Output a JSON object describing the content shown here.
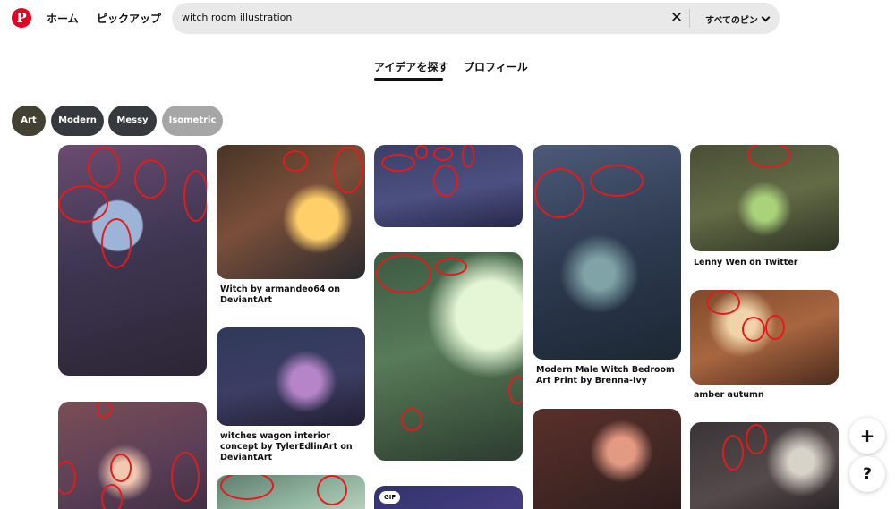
{
  "header": {
    "logo": "P",
    "nav": {
      "home": "ホーム",
      "pickup": "ピックアップ"
    },
    "search": {
      "value": "witch room illustration",
      "clear_icon": "close-icon",
      "scope": "すべてのピン"
    }
  },
  "tabs": [
    {
      "label": "アイデアを探す",
      "active": true
    },
    {
      "label": "プロフィール",
      "active": false
    }
  ],
  "chips": [
    {
      "label": "Art",
      "color": "#434232"
    },
    {
      "label": "Modern",
      "color": "#36393d"
    },
    {
      "label": "Messy",
      "color": "#36393d"
    },
    {
      "label": "Isometric",
      "color": "#a6a6a6"
    }
  ],
  "pins": {
    "armandeo": {
      "caption": "Witch by armandeo64 on DeviantArt"
    },
    "tyler": {
      "caption": "witches wagon interior concept by TylerEdlinArt on DeviantArt"
    },
    "brenna": {
      "caption": "Modern Male Witch Bedroom Art Print by Brenna-Ivy"
    },
    "lenny": {
      "caption": "Lenny Wen on Twitter"
    },
    "amber": {
      "caption": "amber autumn"
    },
    "gif_badge": "GIF"
  },
  "annotation_color": "#e31b1b",
  "fab": {
    "plus": "+",
    "help": "?"
  }
}
